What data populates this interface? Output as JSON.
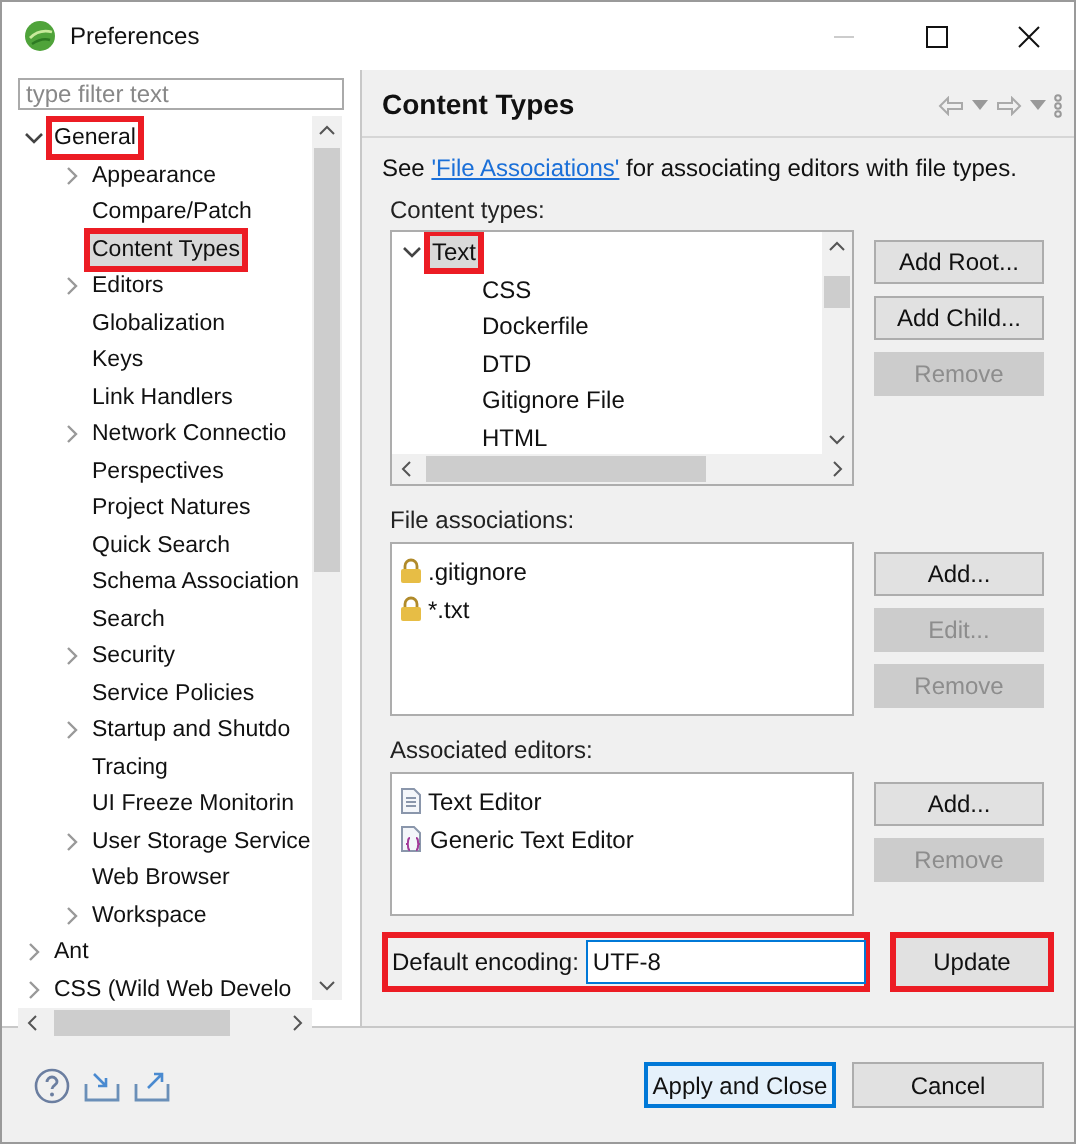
{
  "window": {
    "title": "Preferences"
  },
  "filter": {
    "placeholder": "type filter text"
  },
  "tree": [
    {
      "label": "General",
      "expandable": true,
      "expanded": true,
      "selected": false,
      "highlighted": true,
      "children": [
        {
          "label": "Appearance",
          "expandable": true,
          "expanded": false,
          "selected": false,
          "highlighted": false
        },
        {
          "label": "Compare/Patch",
          "expandable": false,
          "selected": false,
          "highlighted": false
        },
        {
          "label": "Content Types",
          "expandable": false,
          "selected": true,
          "highlighted": true
        },
        {
          "label": "Editors",
          "expandable": true,
          "expanded": false,
          "selected": false,
          "highlighted": false
        },
        {
          "label": "Globalization",
          "expandable": false,
          "selected": false,
          "highlighted": false
        },
        {
          "label": "Keys",
          "expandable": false,
          "selected": false,
          "highlighted": false
        },
        {
          "label": "Link Handlers",
          "expandable": false,
          "selected": false,
          "highlighted": false
        },
        {
          "label": "Network Connectio",
          "expandable": true,
          "expanded": false,
          "selected": false,
          "highlighted": false
        },
        {
          "label": "Perspectives",
          "expandable": false,
          "selected": false,
          "highlighted": false
        },
        {
          "label": "Project Natures",
          "expandable": false,
          "selected": false,
          "highlighted": false
        },
        {
          "label": "Quick Search",
          "expandable": false,
          "selected": false,
          "highlighted": false
        },
        {
          "label": "Schema Association",
          "expandable": false,
          "selected": false,
          "highlighted": false
        },
        {
          "label": "Search",
          "expandable": false,
          "selected": false,
          "highlighted": false
        },
        {
          "label": "Security",
          "expandable": true,
          "expanded": false,
          "selected": false,
          "highlighted": false
        },
        {
          "label": "Service Policies",
          "expandable": false,
          "selected": false,
          "highlighted": false
        },
        {
          "label": "Startup and Shutdo",
          "expandable": true,
          "expanded": false,
          "selected": false,
          "highlighted": false
        },
        {
          "label": "Tracing",
          "expandable": false,
          "selected": false,
          "highlighted": false
        },
        {
          "label": "UI Freeze Monitorin",
          "expandable": false,
          "selected": false,
          "highlighted": false
        },
        {
          "label": "User Storage Service",
          "expandable": true,
          "expanded": false,
          "selected": false,
          "highlighted": false
        },
        {
          "label": "Web Browser",
          "expandable": false,
          "selected": false,
          "highlighted": false
        },
        {
          "label": "Workspace",
          "expandable": true,
          "expanded": false,
          "selected": false,
          "highlighted": false
        }
      ]
    },
    {
      "label": "Ant",
      "expandable": true,
      "expanded": false,
      "selected": false,
      "highlighted": false
    },
    {
      "label": "CSS (Wild Web Develo",
      "expandable": true,
      "expanded": false,
      "selected": false,
      "highlighted": false
    }
  ],
  "page": {
    "title": "Content Types",
    "intro": "See",
    "link": "'File Associations'",
    "outro": "for associating editors with file types."
  },
  "content_types": {
    "label": "Content types:",
    "items": [
      {
        "label": "Text",
        "expandable": true,
        "expanded": true,
        "selected": true,
        "highlighted": true,
        "children": [
          {
            "label": "CSS",
            "expandable": false,
            "selected": false,
            "highlighted": false
          },
          {
            "label": "Dockerfile",
            "expandable": false,
            "selected": false,
            "highlighted": false
          },
          {
            "label": "DTD",
            "expandable": false,
            "selected": false,
            "highlighted": false
          },
          {
            "label": "Gitignore File",
            "expandable": false,
            "selected": false,
            "highlighted": false
          },
          {
            "label": "HTML",
            "expandable": false,
            "selected": false,
            "highlighted": false
          }
        ]
      }
    ],
    "buttons": [
      {
        "label": "Add Root...",
        "disabled": false
      },
      {
        "label": "Add Child...",
        "disabled": false
      },
      {
        "label": "Remove",
        "disabled": true
      }
    ]
  },
  "file_associations": {
    "label": "File associations:",
    "items": [
      {
        "label": ".gitignore",
        "kind": "locked"
      },
      {
        "label": "*.txt",
        "kind": "locked"
      }
    ],
    "buttons": [
      {
        "label": "Add...",
        "disabled": false
      },
      {
        "label": "Edit...",
        "disabled": true
      },
      {
        "label": "Remove",
        "disabled": true
      }
    ]
  },
  "associated_editors": {
    "label": "Associated editors:",
    "items": [
      {
        "label": "Text Editor",
        "kind": "text-editor"
      },
      {
        "label": "Generic Text Editor",
        "kind": "generic-editor"
      }
    ],
    "buttons": [
      {
        "label": "Add...",
        "disabled": false
      },
      {
        "label": "Remove",
        "disabled": true
      }
    ]
  },
  "encoding": {
    "label": "Default encoding:",
    "value": "UTF-8",
    "highlighted": true
  },
  "update_button": {
    "label": "Update",
    "highlighted": true
  },
  "footer_buttons": [
    {
      "label": "Apply and Close",
      "default": true
    },
    {
      "label": "Cancel",
      "default": false
    }
  ]
}
